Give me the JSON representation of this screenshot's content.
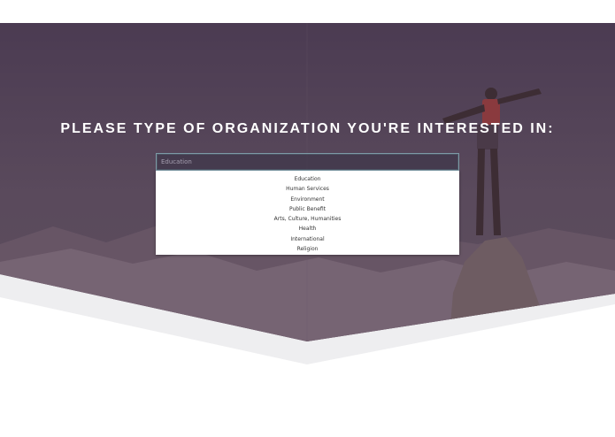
{
  "hero": {
    "heading": "PLEASE TYPE OF ORGANIZATION YOU'RE INTERESTED IN:"
  },
  "search": {
    "placeholder": "Education",
    "value": ""
  },
  "dropdown": {
    "options": [
      "Education",
      "Human Services",
      "Environment",
      "Public Benefit",
      "Arts, Culture, Humanities",
      "Health",
      "International",
      "Religion"
    ]
  }
}
